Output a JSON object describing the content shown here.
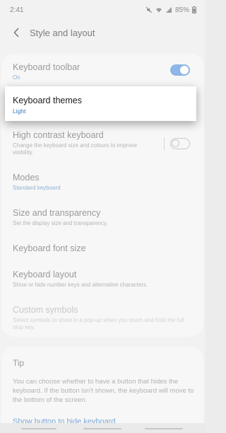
{
  "status_bar": {
    "time": "2:41",
    "battery": "85%",
    "icons": [
      "mute-icon",
      "wifi-icon",
      "signal-icon",
      "battery-icon"
    ]
  },
  "header": {
    "title": "Style and layout",
    "back_icon": "chevron-left-icon"
  },
  "settings": {
    "keyboard_toolbar": {
      "label": "Keyboard toolbar",
      "status": "On",
      "toggle": "on"
    },
    "keyboard_themes": {
      "label": "Keyboard themes",
      "status": "Light"
    },
    "high_contrast": {
      "label": "High contrast keyboard",
      "description": "Change the keyboard size and colours to improve visibility.",
      "toggle": "off"
    },
    "modes": {
      "label": "Modes",
      "status": "Standard keyboard"
    },
    "size_transparency": {
      "label": "Size and transparency",
      "description": "Set the display size and transparency."
    },
    "font_size": {
      "label": "Keyboard font size"
    },
    "keyboard_layout": {
      "label": "Keyboard layout",
      "description": "Show or hide number keys and alternative characters."
    },
    "custom_symbols": {
      "label": "Custom symbols",
      "description": "Select symbols to show in a pop-up when you touch and hold the full stop key."
    }
  },
  "tip": {
    "title": "Tip",
    "body": "You can choose whether to have a button that hides the keyboard. If the button isn't shown, the keyboard will move to the bottom of the screen.",
    "link": "Show button to hide keyboard"
  },
  "colors": {
    "accent": "#2f77c4",
    "toggle_on": "#8eb6e6",
    "background": "#f2f2f2"
  }
}
